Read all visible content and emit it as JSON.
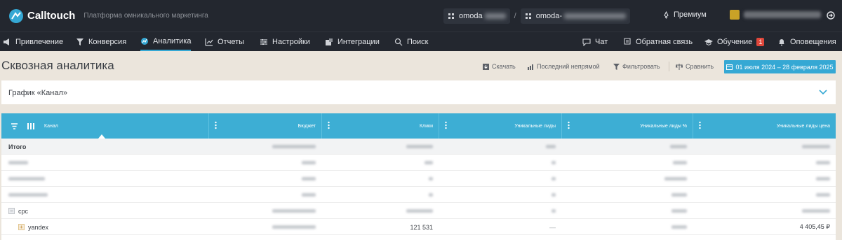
{
  "topbar": {
    "logo_text": "Calltouch",
    "tagline": "Платформа омникального маркетинга",
    "project_1": "omoda",
    "project_2": "omoda-",
    "premium_label": "Премиум",
    "user_name": "username@domain.ru"
  },
  "nav": {
    "items": [
      {
        "label": "Привлечение"
      },
      {
        "label": "Конверсия"
      },
      {
        "label": "Аналитика"
      },
      {
        "label": "Отчеты"
      },
      {
        "label": "Настройки"
      },
      {
        "label": "Интеграции"
      },
      {
        "label": "Поиск"
      }
    ],
    "chat_label": "Чат",
    "feedback_label": "Обратная связь",
    "learning_label": "Обучение",
    "learning_badge": "1",
    "alerts_label": "Оповещения"
  },
  "page": {
    "title": "Сквозная аналитика",
    "download_label": "Скачать",
    "model_label": "Последний непрямой",
    "filter_label": "Фильтровать",
    "compare_label": "Сравнить",
    "date_range": "01 июля 2024 – 28 февраля 2025"
  },
  "chart_panel": {
    "title": "График «Канал»"
  },
  "table": {
    "columns": [
      "Канал",
      "Бюджет",
      "Клики",
      "Уникальные лиды",
      "Уникальные лиды %",
      "Уникальные лиды цена"
    ],
    "rows": [
      {
        "name": "Итого",
        "budget": "",
        "clicks": "",
        "leads": "",
        "leads_pct": "",
        "lead_price": ""
      },
      {
        "name": "",
        "budget": "",
        "clicks": "",
        "leads": "",
        "leads_pct": "",
        "lead_price": ""
      },
      {
        "name": "",
        "budget": "",
        "clicks": "",
        "leads": "",
        "leads_pct": "",
        "lead_price": ""
      },
      {
        "name": "",
        "budget": "",
        "clicks": "",
        "leads": "",
        "leads_pct": "",
        "lead_price": ""
      },
      {
        "name": "cpc",
        "budget": "",
        "clicks": "",
        "leads": "",
        "leads_pct": "",
        "lead_price": ""
      },
      {
        "name": "yandex",
        "budget": "",
        "clicks": "121 531",
        "leads": "—",
        "leads_pct": "",
        "lead_price": "4 405,45 ₽"
      }
    ]
  },
  "colors": {
    "topbar_bg": "#23272f",
    "accent": "#35a8d4",
    "table_header": "#3daed4",
    "page_bg": "#ebe5dc"
  }
}
